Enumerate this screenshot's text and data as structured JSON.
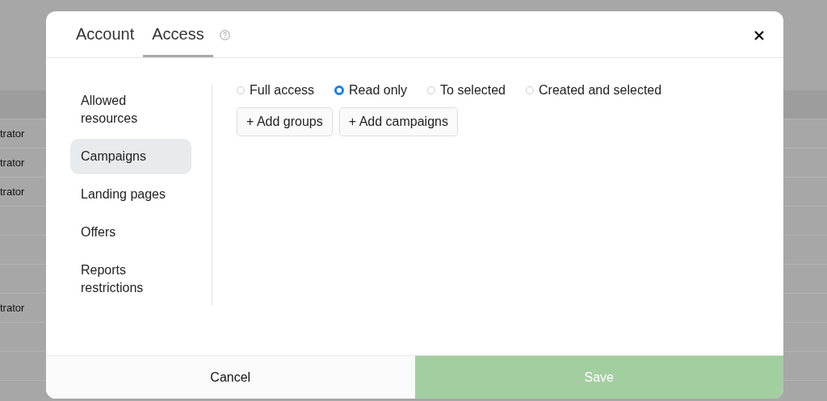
{
  "background_table": {
    "rows": [
      {},
      {
        "cell": "trator"
      },
      {
        "cell": "trator"
      },
      {
        "cell": "trator"
      },
      {},
      {},
      {},
      {
        "cell": "trator"
      },
      {},
      {}
    ]
  },
  "dialog": {
    "tabs": [
      {
        "label": "Account",
        "selected": false
      },
      {
        "label": "Access",
        "selected": true
      }
    ],
    "sidebar": {
      "items": [
        {
          "label": "Allowed resources",
          "selected": false
        },
        {
          "label": "Campaigns",
          "selected": true
        },
        {
          "label": "Landing pages",
          "selected": false
        },
        {
          "label": "Offers",
          "selected": false
        },
        {
          "label": "Reports restrictions",
          "selected": false
        }
      ]
    },
    "access_options": [
      {
        "label": "Full access",
        "selected": false
      },
      {
        "label": "Read only",
        "selected": true
      },
      {
        "label": "To selected",
        "selected": false
      },
      {
        "label": "Created and selected",
        "selected": false
      }
    ],
    "actions": [
      "+ Add groups",
      "+ Add campaigns"
    ],
    "footer": {
      "cancel": "Cancel",
      "save": {
        "label": "Save",
        "disabled": true
      }
    }
  }
}
